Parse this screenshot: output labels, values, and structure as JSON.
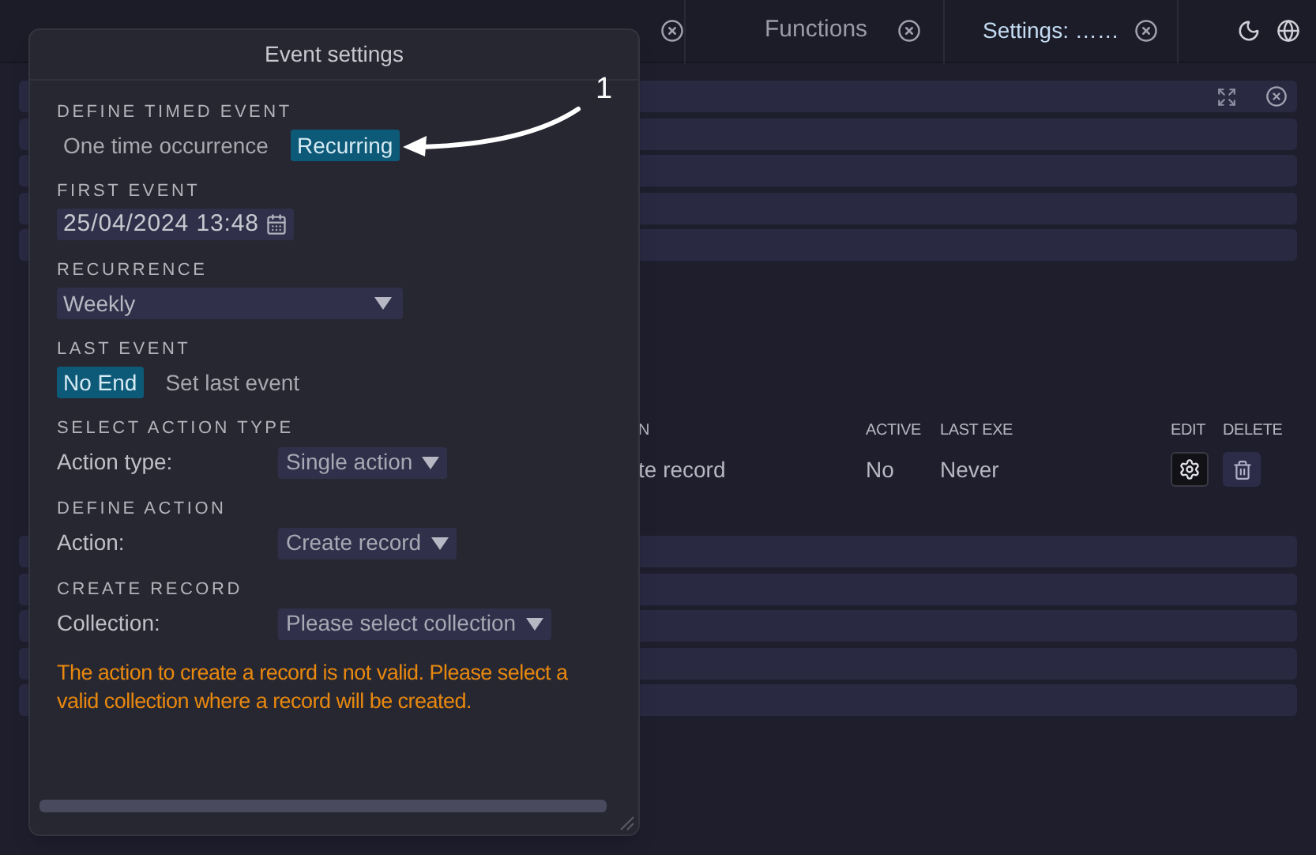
{
  "top_bar": {
    "tabs": [
      {
        "label": "Functions",
        "selected": false
      },
      {
        "label": "Settings: ……",
        "selected": true
      }
    ]
  },
  "table": {
    "columns": [
      "N",
      "ACTIVE",
      "LAST EXE",
      "EDIT",
      "DELETE"
    ],
    "rows": [
      {
        "cells": [
          "te record",
          "No",
          "Never"
        ]
      }
    ]
  },
  "dialog": {
    "title": "Event settings",
    "sections": [
      {
        "kind": "toggle",
        "label": "DEFINE TIMED EVENT",
        "options": [
          {
            "label": "One time occurrence",
            "selected": false
          },
          {
            "label": "Recurring",
            "selected": true
          }
        ]
      },
      {
        "kind": "date",
        "label": "FIRST EVENT",
        "value": "25/04/2024 13:48"
      },
      {
        "kind": "select",
        "label": "RECURRENCE",
        "value": "Weekly"
      },
      {
        "kind": "toggle",
        "label": "LAST EVENT",
        "options": [
          {
            "label": "No End",
            "selected": true
          },
          {
            "label": "Set last event",
            "selected": false
          }
        ]
      },
      {
        "kind": "labeled_select",
        "label": "SELECT ACTION TYPE",
        "field": "Action type:",
        "value": "Single action"
      },
      {
        "kind": "labeled_select",
        "label": "DEFINE ACTION",
        "field": "Action:",
        "value": "Create record"
      },
      {
        "kind": "labeled_select",
        "label": "CREATE RECORD",
        "field": "Collection:",
        "value": "Please select collection"
      }
    ],
    "error": "The action to create a record is not valid. Please select a valid collection where a record will be created."
  },
  "annotation": {
    "label": "1"
  }
}
